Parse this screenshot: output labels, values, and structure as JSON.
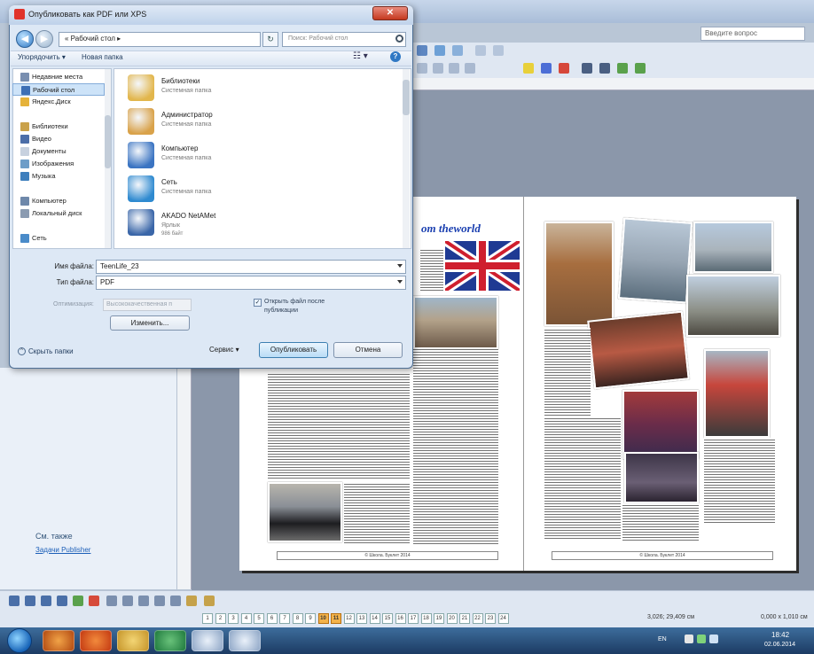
{
  "publisher": {
    "help_placeholder": "Введите вопрос",
    "see_also": "См. также",
    "see_also_link": "Задачи Publisher",
    "article_title": "om theworld",
    "footer_left": "© Школа. Буклет 2014",
    "footer_right": "© Школа. Буклет 2014",
    "status_coords1": "3,026; 29,409 см",
    "status_coords2": "0,000 x 1,010 см"
  },
  "page_strip": {
    "pages": [
      "1",
      "2",
      "3",
      "4",
      "5",
      "6",
      "7",
      "8",
      "9",
      "10",
      "11",
      "12",
      "13",
      "14",
      "15",
      "16",
      "17",
      "18",
      "19",
      "20",
      "21",
      "22",
      "23",
      "24"
    ],
    "active": [
      "10",
      "11"
    ]
  },
  "taskbar": {
    "lang": "EN",
    "time": "18:42",
    "date": "02.06.2014"
  },
  "dialog": {
    "title": "Опубликовать как PDF или XPS",
    "close_label": "✕",
    "address": "« Рабочий стол ▸",
    "search_placeholder": "Поиск: Рабочий стол",
    "cmd_organize": "Упорядочить ▾",
    "cmd_newfolder": "Новая папка",
    "nav_items": [
      {
        "label": "Недавние места",
        "color": "#7a8fb0"
      },
      {
        "label": "Рабочий стол",
        "color": "#3d6fb5",
        "selected": true
      },
      {
        "label": "Яндекс.Диск",
        "color": "#e5b23a"
      },
      {
        "label": "",
        "color": ""
      },
      {
        "label": "Библиотеки",
        "color": "#caa24b"
      },
      {
        "label": "Видео",
        "color": "#4c6ea8"
      },
      {
        "label": "Документы",
        "color": "#c7d1df"
      },
      {
        "label": "Изображения",
        "color": "#6d9dc8"
      },
      {
        "label": "Музыка",
        "color": "#3e7fbd"
      },
      {
        "label": "",
        "color": ""
      },
      {
        "label": "Компьютер",
        "color": "#6e88aa"
      },
      {
        "label": "Локальный диск",
        "color": "#8b9bb1"
      },
      {
        "label": "",
        "color": ""
      },
      {
        "label": "Сеть",
        "color": "#4a8bc9"
      }
    ],
    "files": [
      {
        "name": "Библиотеки",
        "type": "Системная папка",
        "type2": "",
        "color": "#e2b64c"
      },
      {
        "name": "Администратор",
        "type": "Системная папка",
        "type2": "",
        "color": "#d9a24a"
      },
      {
        "name": "Компьютер",
        "type": "Системная папка",
        "type2": "",
        "color": "#3b74c2"
      },
      {
        "name": "Сеть",
        "type": "Системная папка",
        "type2": "",
        "color": "#2f8ad0"
      },
      {
        "name": "AKADO NetAMet",
        "type": "Ярлык",
        "type2": "986 байт",
        "color": "#3a66a8"
      }
    ],
    "filename_label": "Имя файла:",
    "filename_value": "TeenLife_23",
    "filetype_label": "Тип файла:",
    "filetype_value": "PDF",
    "optimize_label": "Оптимизация:",
    "optimize_value": "Высококачественная п",
    "change_button": "Изменить...",
    "open_after_label": "Открыть файл после публикации",
    "open_after_checked": true,
    "hide_folders": "Скрыть папки",
    "service_menu": "Сервис ▾",
    "publish_button": "Опубликовать",
    "cancel_button": "Отмена"
  }
}
